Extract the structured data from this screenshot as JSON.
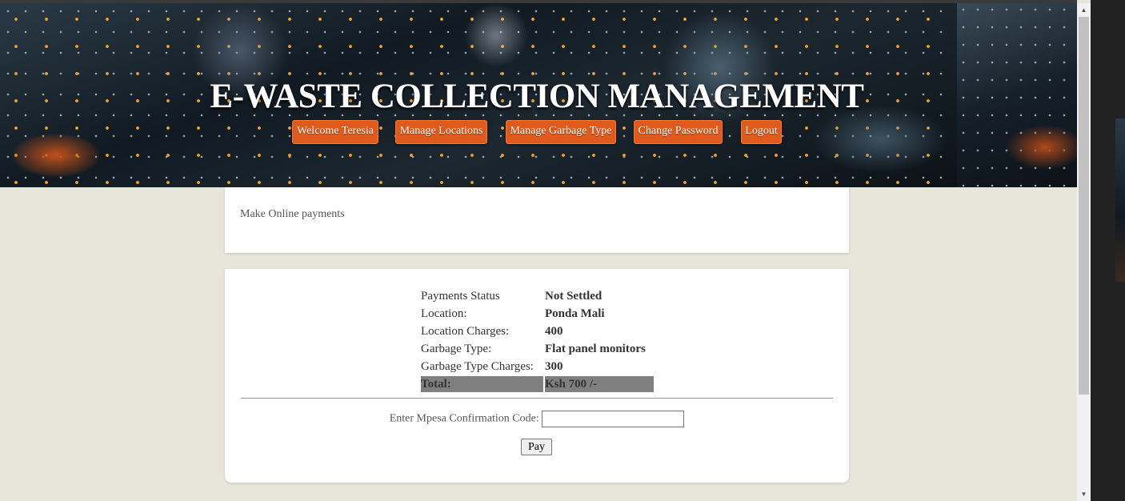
{
  "site": {
    "title": "E-WASTE COLLECTION MANAGEMENT"
  },
  "nav": [
    {
      "label": "Welcome Teresia"
    },
    {
      "label": "Manage Locations"
    },
    {
      "label": "Manage Garbage Type"
    },
    {
      "label": "Change Password"
    },
    {
      "label": "Logout"
    }
  ],
  "intro": {
    "text": "Make Online payments"
  },
  "payment": {
    "rows": [
      {
        "label": "Payments Status",
        "value": "Not Settled"
      },
      {
        "label": "Location:",
        "value": "Ponda Mali"
      },
      {
        "label": "Location Charges:",
        "value": "400"
      },
      {
        "label": "Garbage Type:",
        "value": "Flat panel monitors"
      },
      {
        "label": "Garbage Type Charges:",
        "value": "300"
      }
    ],
    "total": {
      "label": "Total:",
      "value": "Ksh 700 /-"
    }
  },
  "form": {
    "code_label": "Enter Mpesa Confirmation Code:",
    "code_value": "",
    "pay_label": "Pay"
  },
  "scrollbar": {
    "up_icon": "▲",
    "down_icon": "▼"
  },
  "colors": {
    "nav_button": "#e05a1c",
    "background": "#e6e6da",
    "total_row": "#808080"
  }
}
